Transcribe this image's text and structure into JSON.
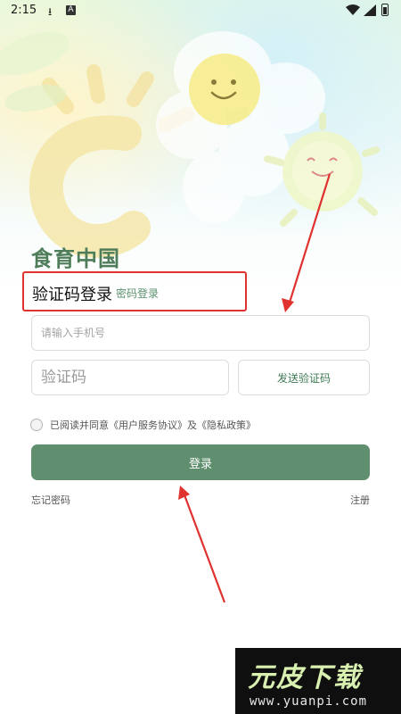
{
  "status_bar": {
    "time": "2:15",
    "download_icon": "download-icon",
    "a_icon_glyph": "A",
    "wifi_icon": "wifi-icon",
    "signal_icon": "signal-icon",
    "battery_icon": "battery-icon"
  },
  "app": {
    "title": "食育中国"
  },
  "tabs": {
    "active": "验证码登录",
    "inactive": "密码登录"
  },
  "form": {
    "phone_placeholder": "请输入手机号",
    "code_placeholder": "验证码",
    "send_code_label": "发送验证码",
    "agreement": {
      "prefix": "已阅读并同意",
      "user_agreement": "《用户服务协议》",
      "and": "及",
      "privacy_policy": "《隐私政策》",
      "checked": false
    },
    "login_label": "登录",
    "forgot_label": "忘记密码",
    "register_label": "注册"
  },
  "watermark": {
    "brand": "元皮下载",
    "url": "www.yuanpi.com"
  },
  "colors": {
    "accent": "#5f8f6e",
    "title": "#4f7d5a",
    "highlight": "#e0322e"
  }
}
